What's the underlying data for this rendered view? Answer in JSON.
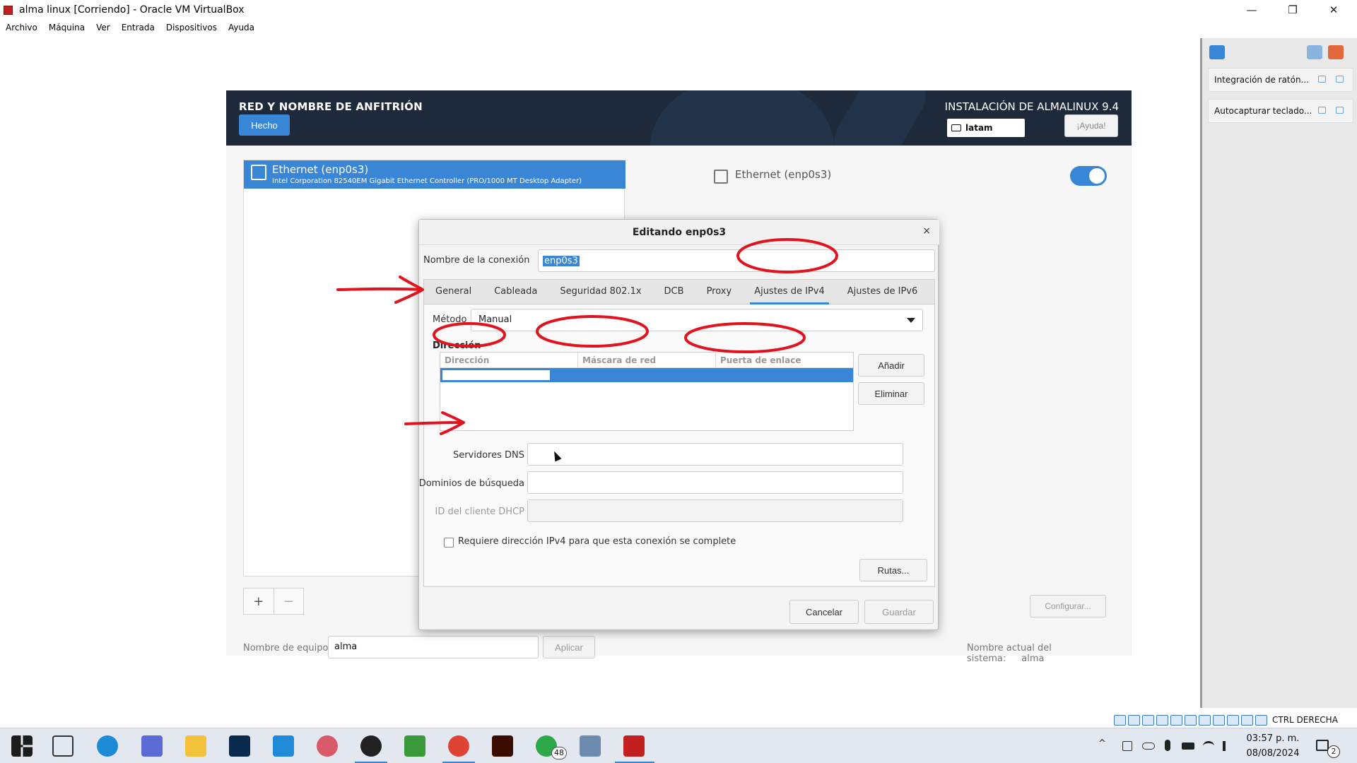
{
  "host": {
    "title": "alma linux [Corriendo] - Oracle VM VirtualBox",
    "menu": [
      "Archivo",
      "Máquina",
      "Ver",
      "Entrada",
      "Dispositivos",
      "Ayuda"
    ],
    "controls": {
      "minimize": "—",
      "restore": "❐",
      "close": "✕"
    }
  },
  "installer": {
    "spoke_title": "RED Y NOMBRE DE ANFITRIÓN",
    "done_label": "Hecho",
    "product": "INSTALACIÓN DE ALMALINUX 9.4",
    "keyboard": "latam",
    "help_label": "¡Ayuda!",
    "device_name": "Ethernet (enp0s3)",
    "device_desc": "Intel Corporation 82540EM Gigabit Ethernet Controller (PRO/1000 MT Desktop Adapter)",
    "detail_title": "Ethernet (enp0s3)",
    "add": "+",
    "remove": "−",
    "configure_label": "Configurar...",
    "hostname_label": "Nombre de equipo:",
    "hostname_value": "alma",
    "apply_label": "Aplicar",
    "current_host_label": "Nombre actual del sistema:",
    "current_host_value": "alma"
  },
  "dialog": {
    "title": "Editando enp0s3",
    "close": "×",
    "conn_label": "Nombre de la conexión",
    "conn_value": "enp0s3",
    "tabs": [
      "General",
      "Cableada",
      "Seguridad 802.1x",
      "DCB",
      "Proxy",
      "Ajustes de IPv4",
      "Ajustes de IPv6"
    ],
    "active_tab": "Ajustes de IPv4",
    "method_label": "Método",
    "method_value": "Manual",
    "address_heading": "Dirección",
    "columns": [
      "Dirección",
      "Máscara de red",
      "Puerta de enlace"
    ],
    "add_label": "Añadir",
    "delete_label": "Eliminar",
    "dns_label": "Servidores DNS",
    "search_label": "Dominios de búsqueda",
    "dhcp_label": "ID del cliente DHCP",
    "checkbox_label": "Requiere dirección IPv4 para que esta conexión se complete",
    "routes_label": "Rutas...",
    "cancel_label": "Cancelar",
    "save_label": "Guardar"
  },
  "side_panel": {
    "notifications": [
      "Integración de ratón...",
      "Autocapturar teclado..."
    ]
  },
  "vbox_status": {
    "host_key": "CTRL DERECHA"
  },
  "taskbar": {
    "whatsapp_badge": "48",
    "time": "03:57 p. m.",
    "date": "08/08/2024",
    "notif_count": "2"
  },
  "colors": {
    "accent": "#3a86d6",
    "header": "#1e2a3a",
    "annotation": "#e0141e"
  }
}
